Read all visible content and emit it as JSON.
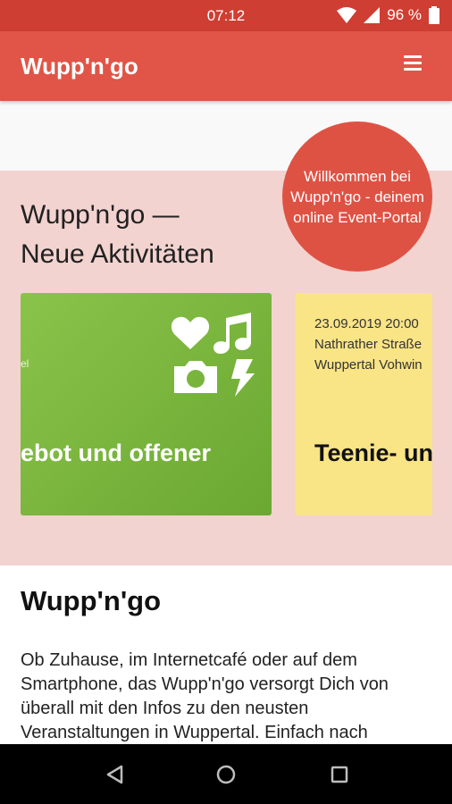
{
  "status": {
    "time": "07:12",
    "battery": "96 %"
  },
  "appbar": {
    "title": "Wupp'n'go"
  },
  "welcome_badge": {
    "text": "Willkommen bei Wupp'n'go - deinem online Event-Portal"
  },
  "hero": {
    "title_line1": "Wupp'n'go —",
    "title_line2": "Neue Aktivitäten"
  },
  "cards": [
    {
      "tiny": "el",
      "title": "ebot und offener",
      "icons": [
        "heart-icon",
        "music-icon",
        "camera-icon",
        "lightning-icon"
      ]
    },
    {
      "date": "23.09.2019 20:00",
      "street": "Nathrather Straße",
      "city": "Wuppertal Vohwin",
      "title": "Teenie- und"
    }
  ],
  "about": {
    "heading": "Wupp'n'go",
    "text": "Ob Zuhause, im Internetcafé oder auf dem Smartphone, das Wupp'n'go versorgt Dich von überall mit den Infos zu den neusten Veranstaltungen in Wuppertal. Einfach nach"
  },
  "navigation": {
    "buttons": [
      "back-icon",
      "home-icon",
      "recents-icon"
    ]
  }
}
